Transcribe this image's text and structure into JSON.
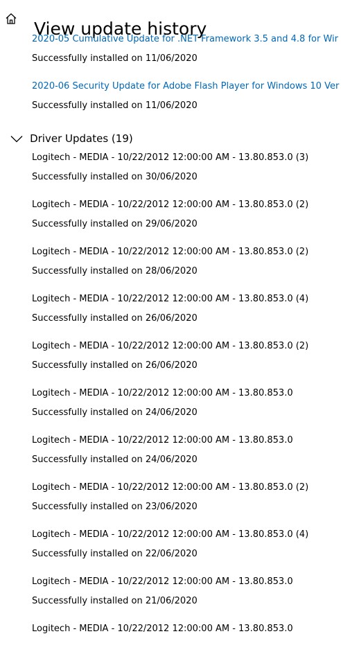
{
  "header": {
    "title": "View update history",
    "home_icon": "home-icon"
  },
  "quality_updates": [
    {
      "name": "2020-05 Cumulative Update for .NET Framework 3.5 and 4.8 for Wir",
      "status": "Successfully installed on 11/06/2020"
    },
    {
      "name": "2020-06 Security Update for Adobe Flash Player for Windows 10 Ver",
      "status": "Successfully installed on 11/06/2020"
    }
  ],
  "driver_section": {
    "title": "Driver Updates (19)",
    "chevron_icon": "chevron-down-icon",
    "items": [
      {
        "name": "Logitech - MEDIA - 10/22/2012 12:00:00 AM - 13.80.853.0 (3)",
        "status": "Successfully installed on 30/06/2020"
      },
      {
        "name": "Logitech - MEDIA - 10/22/2012 12:00:00 AM - 13.80.853.0 (2)",
        "status": "Successfully installed on 29/06/2020"
      },
      {
        "name": "Logitech - MEDIA - 10/22/2012 12:00:00 AM - 13.80.853.0 (2)",
        "status": "Successfully installed on 28/06/2020"
      },
      {
        "name": "Logitech - MEDIA - 10/22/2012 12:00:00 AM - 13.80.853.0 (4)",
        "status": "Successfully installed on 26/06/2020"
      },
      {
        "name": "Logitech - MEDIA - 10/22/2012 12:00:00 AM - 13.80.853.0 (2)",
        "status": "Successfully installed on 26/06/2020"
      },
      {
        "name": "Logitech - MEDIA - 10/22/2012 12:00:00 AM - 13.80.853.0",
        "status": "Successfully installed on 24/06/2020"
      },
      {
        "name": "Logitech - MEDIA - 10/22/2012 12:00:00 AM - 13.80.853.0",
        "status": "Successfully installed on 24/06/2020"
      },
      {
        "name": "Logitech - MEDIA - 10/22/2012 12:00:00 AM - 13.80.853.0 (2)",
        "status": "Successfully installed on 23/06/2020"
      },
      {
        "name": "Logitech - MEDIA - 10/22/2012 12:00:00 AM - 13.80.853.0 (4)",
        "status": "Successfully installed on 22/06/2020"
      },
      {
        "name": "Logitech - MEDIA - 10/22/2012 12:00:00 AM - 13.80.853.0",
        "status": "Successfully installed on 21/06/2020"
      },
      {
        "name": "Logitech - MEDIA - 10/22/2012 12:00:00 AM - 13.80.853.0",
        "status": ""
      }
    ]
  },
  "colors": {
    "link": "#0067b8",
    "text": "#000000",
    "background": "#ffffff"
  }
}
